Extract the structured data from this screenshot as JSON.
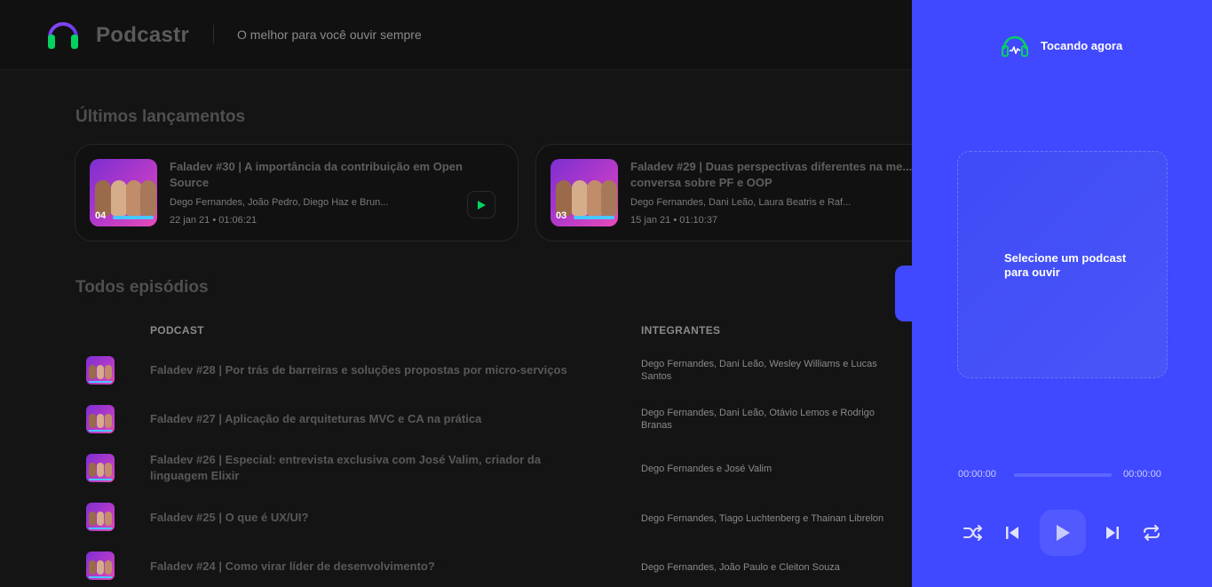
{
  "header": {
    "app_name": "Podcastr",
    "tagline": "O melhor para você ouvir sempre",
    "logo_icon": "headphones-icon",
    "accent_color": "#04d361"
  },
  "latest": {
    "title": "Últimos lançamentos",
    "episodes": [
      {
        "title": "Faladev #30 | A importância da contribuição em Open Source",
        "members": "Dego Fernandes, João Pedro, Diego Haz e Brun...",
        "date": "22 jan 21",
        "duration": "01:06:21",
        "badge": "04"
      },
      {
        "title": "Faladev #29 | Duas perspectivas diferentes na me...",
        "title_line2": "conversa sobre PF e OOP",
        "members": "Dego Fernandes, Dani Leão, Laura Beatris e Raf...",
        "date": "15 jan 21",
        "duration": "01:10:37",
        "badge": "03"
      }
    ]
  },
  "all": {
    "title": "Todos episódios",
    "columns": {
      "podcast": "PODCAST",
      "members": "INTEGRANTES"
    },
    "rows": [
      {
        "title": "Faladev #28 | Por trás de barreiras e soluções propostas por micro-serviços",
        "members": "Dego Fernandes, Dani Leão, Wesley Williams e Lucas Santos"
      },
      {
        "title": "Faladev #27 | Aplicação de arquiteturas MVC e CA na prática",
        "members": "Dego Fernandes, Dani Leão, Otávio Lemos e Rodrigo Branas"
      },
      {
        "title": "Faladev #26 | Especial: entrevista exclusiva com José Valim, criador da linguagem Elixir",
        "members": "Dego Fernandes e José Valim"
      },
      {
        "title": "Faladev #25 | O que é UX/UI?",
        "members": "Dego Fernandes, Tiago Luchtenberg e Thainan Librelon"
      },
      {
        "title": "Faladev #24 | Como virar líder de desenvolvimento?",
        "members": "Dego Fernandes, João Paulo e Cleiton Souza"
      }
    ]
  },
  "player": {
    "heading": "Tocando agora",
    "empty_message": "Selecione um podcast para ouvir",
    "time_current": "00:00:00",
    "time_total": "00:00:00",
    "progress": 0,
    "background_color": "#4049ff"
  }
}
